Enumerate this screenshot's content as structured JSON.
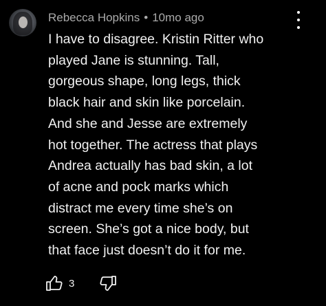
{
  "comment": {
    "author": "Rebecca Hopkins",
    "separator": "•",
    "timestamp": "10mo ago",
    "lines": [
      "I have to disagree. Kristin Ritter who",
      "played Jane is stunning. Tall,",
      "gorgeous shape, long legs, thick",
      "black hair and skin like porcelain.",
      "And she and Jesse are extremely",
      "hot together. The actress that plays",
      "Andrea actually has bad skin, a lot",
      "of acne and pock marks which",
      "distract me every time she’s on",
      "screen. She’s got a nice body, but",
      "that face just doesn’t do it for me."
    ],
    "like_count": "3"
  },
  "icons": {
    "avatar": "avatar-photo",
    "more": "more-vertical-icon",
    "like": "thumbs-up-icon",
    "dislike": "thumbs-down-icon"
  },
  "colors": {
    "background": "#000000",
    "meta_text": "#aaaaaa",
    "body_text": "#f1f1f1"
  }
}
